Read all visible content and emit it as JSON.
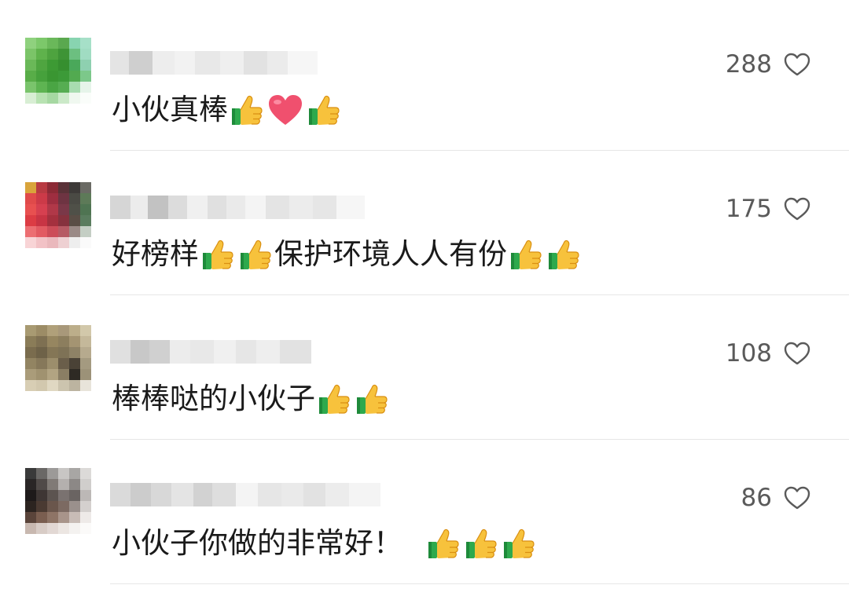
{
  "comments": [
    {
      "text": "小伙真棒",
      "after": [
        "thumbs-up",
        "heart",
        "thumbs-up"
      ],
      "likes": "288"
    },
    {
      "text_parts": [
        "好榜样",
        "保护环境人人有份"
      ],
      "likes": "175"
    },
    {
      "text": "棒棒哒的小伙子",
      "likes": "108"
    },
    {
      "text": "小伙子你做的非常好！",
      "likes": "86"
    }
  ],
  "icons": {
    "like": "heart-outline-icon",
    "thumbs_up": "thumbs-up-emoji",
    "heart": "red-heart-emoji"
  },
  "colors": {
    "text": "#1a1a1a",
    "count": "#5a5a5a",
    "divider": "#e6e6e6",
    "thumb": "#f5b82e",
    "cuff": "#2aa84a",
    "heart": "#f0506e"
  }
}
